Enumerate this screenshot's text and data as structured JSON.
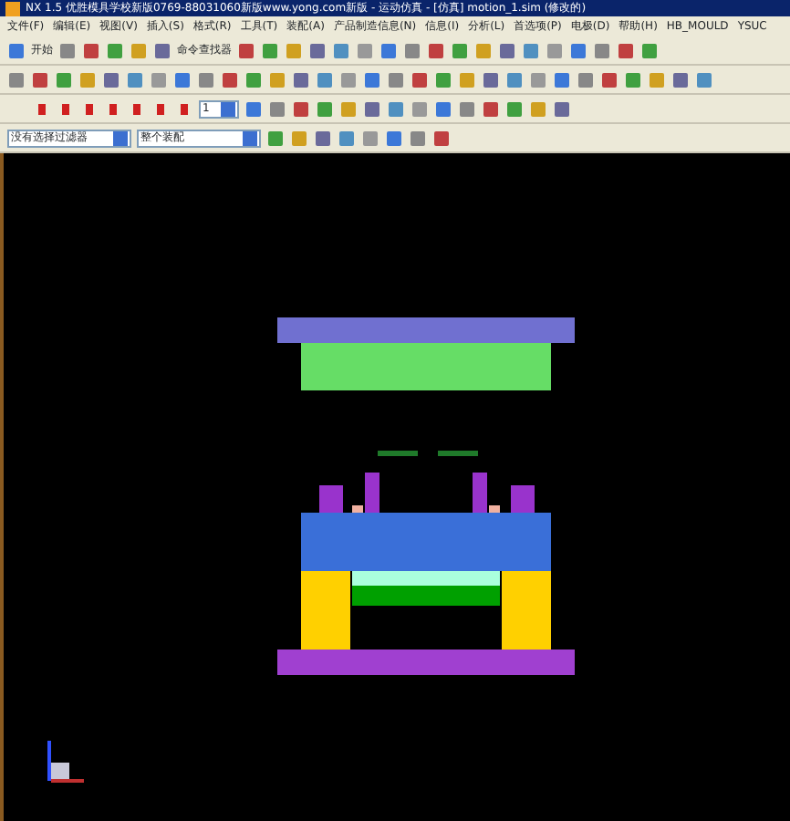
{
  "window": {
    "title": "NX 1.5 优胜模具学校新版0769-88031060新版www.yong.com新版 - 运动仿真 - [仿真] motion_1.sim (修改的)"
  },
  "menu": [
    "文件(F)",
    "编辑(E)",
    "视图(V)",
    "插入(S)",
    "格式(R)",
    "工具(T)",
    "装配(A)",
    "产品制造信息(N)",
    "信息(I)",
    "分析(L)",
    "首选项(P)",
    "电极(D)",
    "帮助(H)",
    "HB_MOULD",
    "YSUC"
  ],
  "standard_toolbar": {
    "start": "开始",
    "command_finder": "命令查找器"
  },
  "animation_toolbar": {
    "step": "1"
  },
  "selection_bar": {
    "filter": "没有选择过滤器",
    "scope": "整个装配"
  }
}
